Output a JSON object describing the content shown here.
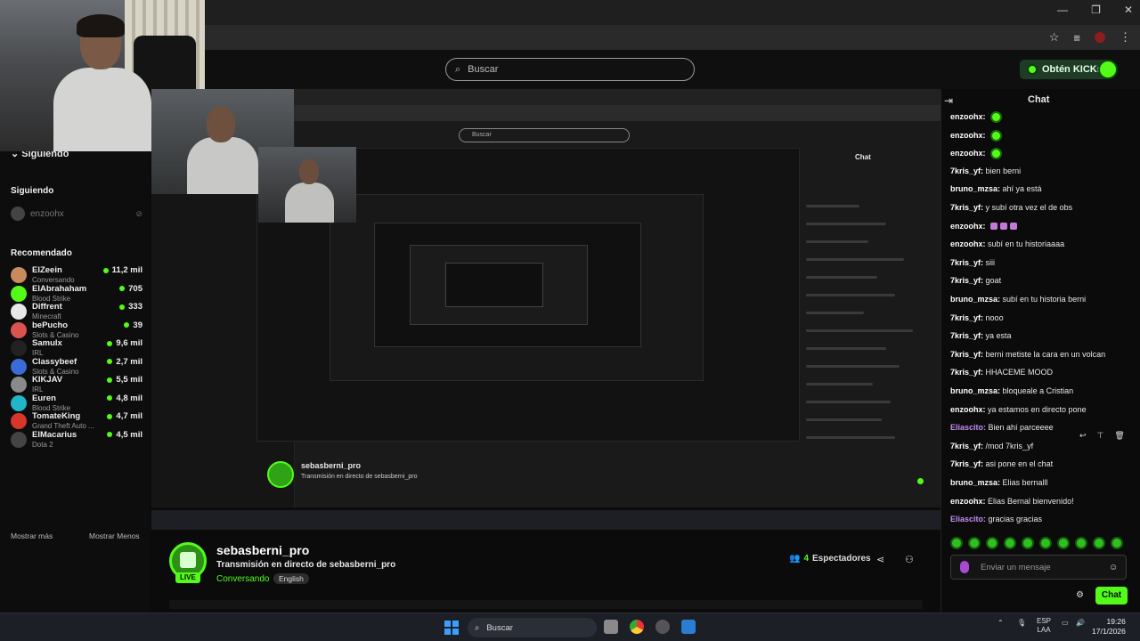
{
  "header": {
    "search_placeholder": "Buscar",
    "kicks_button": "Obtén KICKs"
  },
  "sidebar": {
    "head": "Siguiendo",
    "following_title": "Siguiendo",
    "following": [
      {
        "name": "enzoohx"
      }
    ],
    "recommended_title": "Recomendado",
    "recommended": [
      {
        "name": "ElZeein",
        "category": "Conversando",
        "viewers": "11,2 mil",
        "color": "#c98a5e"
      },
      {
        "name": "ElAbrahaham",
        "category": "Blood Strike",
        "viewers": "705",
        "color": "#53fc18"
      },
      {
        "name": "Diffrent",
        "category": "Minecraft",
        "viewers": "333",
        "color": "#e8e8e8"
      },
      {
        "name": "bePucho",
        "category": "Slots & Casino",
        "viewers": "39",
        "color": "#d9534f"
      },
      {
        "name": "Samulx",
        "category": "IRL",
        "viewers": "9,6 mil",
        "color": "#222222"
      },
      {
        "name": "Classybeef",
        "category": "Slots & Casino",
        "viewers": "2,7 mil",
        "color": "#3b6bd6"
      },
      {
        "name": "KIKJAV",
        "category": "IRL",
        "viewers": "5,5 mil",
        "color": "#8a8a8a"
      },
      {
        "name": "Euren",
        "category": "Blood Strike",
        "viewers": "4,8 mil",
        "color": "#22b4c8"
      },
      {
        "name": "TomateKing",
        "category": "Grand Theft Auto ...",
        "viewers": "4,7 mil",
        "color": "#d9362b"
      },
      {
        "name": "ElMacarius",
        "category": "Dota 2",
        "viewers": "4,5 mil",
        "color": "#444444"
      }
    ],
    "show_more": "Mostrar más",
    "show_less": "Mostrar Menos"
  },
  "stream": {
    "streamer": "sebasberni_pro",
    "live": "LIVE",
    "title": "Transmisión en directo de sebasberni_pro",
    "category": "Conversando",
    "language": "English",
    "viewers_count": "4",
    "viewers_label": "Espectadores"
  },
  "nested": {
    "search": "Buscar",
    "chat_title": "Chat",
    "streamer": "sebasberni_pro",
    "title": "Transmisión en directo de sebasberni_pro"
  },
  "chat": {
    "title": "Chat",
    "messages": [
      {
        "user": "enzoohx:",
        "text": "",
        "color": "#ffffff",
        "emotes": 1,
        "cut": true
      },
      {
        "user": "enzoohx:",
        "text": "",
        "color": "#ffffff",
        "emotes": 1
      },
      {
        "user": "enzoohx:",
        "text": "",
        "color": "#ffffff",
        "emotes": 1
      },
      {
        "user": "7kris_yf:",
        "text": "bien berni",
        "color": "#ffffff"
      },
      {
        "user": "bruno_mzsa:",
        "text": "ahí ya está",
        "color": "#ffffff"
      },
      {
        "user": "7kris_yf:",
        "text": "y subí otra vez el de obs",
        "color": "#ffffff"
      },
      {
        "user": "enzoohx:",
        "text": "",
        "color": "#ffffff",
        "pink": 3
      },
      {
        "user": "enzoohx:",
        "text": "subí en tu historiaaaa",
        "color": "#ffffff"
      },
      {
        "user": "7kris_yf:",
        "text": "siii",
        "color": "#ffffff"
      },
      {
        "user": "7kris_yf:",
        "text": "goat",
        "color": "#ffffff"
      },
      {
        "user": "bruno_mzsa:",
        "text": "subí en tu historia berni",
        "color": "#ffffff"
      },
      {
        "user": "7kris_yf:",
        "text": "nooo",
        "color": "#ffffff"
      },
      {
        "user": "7kris_yf:",
        "text": "ya esta",
        "color": "#ffffff"
      },
      {
        "user": "7kris_yf:",
        "text": "berni metiste la cara en un volcan",
        "color": "#ffffff"
      },
      {
        "user": "7kris_yf:",
        "text": "HHACEME MOOD",
        "color": "#ffffff"
      },
      {
        "user": "bruno_mzsa:",
        "text": "bloqueale a Cristian",
        "color": "#ffffff"
      },
      {
        "user": "enzoohx:",
        "text": "ya estamos en directo pone",
        "color": "#ffffff"
      },
      {
        "user": "Eliascito:",
        "text": "Bien ahí parceeee",
        "color": "#c38df0"
      },
      {
        "user": "7kris_yf:",
        "text": "/mod 7kris_yf",
        "color": "#ffffff"
      },
      {
        "user": "7kris_yf:",
        "text": "asi pone en el chat",
        "color": "#ffffff"
      },
      {
        "user": "bruno_mzsa:",
        "text": "Elias bernalll",
        "color": "#ffffff"
      },
      {
        "user": "enzoohx:",
        "text": "Elias Bernal bienvenido!",
        "color": "#ffffff"
      },
      {
        "user": "Eliascito:",
        "text": "gracias gracias",
        "color": "#c38df0"
      }
    ],
    "input_placeholder": "Enviar un mensaje",
    "send_label": "Chat"
  },
  "taskbar": {
    "search": "Buscar",
    "lang": "ESP",
    "lang2": "LAA",
    "time": "19:26",
    "date": "17/1/2026"
  },
  "colors": {
    "accent": "#53fc18",
    "background": "#0b0b0c"
  }
}
